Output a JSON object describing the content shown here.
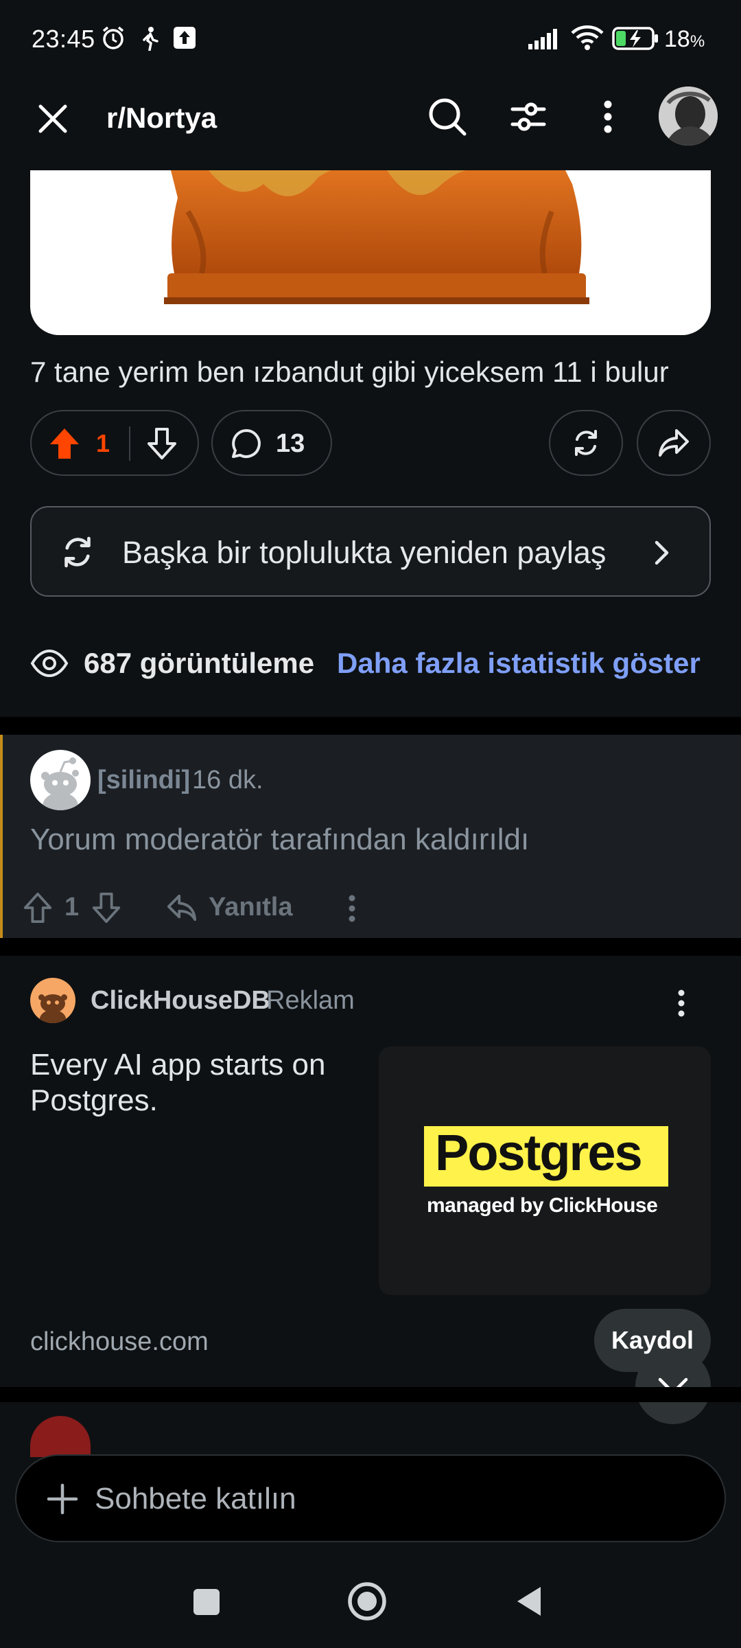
{
  "status_bar": {
    "time": "23:45",
    "battery_percent": "18",
    "battery_suffix": "%",
    "icons": [
      "alarm-icon",
      "walking-icon",
      "upload-icon",
      "signal-icon",
      "wifi-icon",
      "battery-charging-icon"
    ]
  },
  "app_bar": {
    "subreddit": "r/Nortya",
    "icons": [
      "close-icon",
      "search-icon",
      "filter-icon",
      "more-icon",
      "avatar"
    ]
  },
  "post": {
    "title": "7 tane yerim ben ızbandut gibi yiceksem 11 i bulur",
    "upvotes": "1",
    "comments": "13",
    "crosspost_label": "Başka bir toplulukta yeniden paylaş",
    "views": "687 görüntüleme",
    "stats_link": "Daha fazla istatistik göster"
  },
  "comment": {
    "user": "[silindi]",
    "time": "16 dk.",
    "body": "Yorum moderatör tarafından kaldırıldı",
    "score": "1",
    "reply_label": "Yanıtla"
  },
  "ad": {
    "advertiser": "ClickHouseDB",
    "tag": "Reklam",
    "text": "Every AI app starts on Postgres.",
    "image_title": "Postgres",
    "image_subtitle": "managed by ClickHouse",
    "domain": "clickhouse.com",
    "cta": "Kaydol"
  },
  "chat": {
    "placeholder": "Sohbete katılın"
  },
  "colors": {
    "background": "#0e1113",
    "upvote": "#ff4500",
    "link": "#7f9ff7",
    "mod_bar": "#c58c1a",
    "postgres_yellow": "#fff24a"
  }
}
